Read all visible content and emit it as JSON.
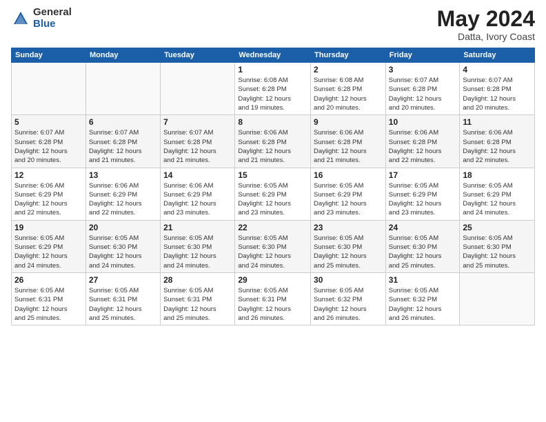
{
  "logo": {
    "general": "General",
    "blue": "Blue"
  },
  "title": {
    "month": "May 2024",
    "location": "Datta, Ivory Coast"
  },
  "weekdays": [
    "Sunday",
    "Monday",
    "Tuesday",
    "Wednesday",
    "Thursday",
    "Friday",
    "Saturday"
  ],
  "weeks": [
    [
      {
        "day": "",
        "info": ""
      },
      {
        "day": "",
        "info": ""
      },
      {
        "day": "",
        "info": ""
      },
      {
        "day": "1",
        "info": "Sunrise: 6:08 AM\nSunset: 6:28 PM\nDaylight: 12 hours\nand 19 minutes."
      },
      {
        "day": "2",
        "info": "Sunrise: 6:08 AM\nSunset: 6:28 PM\nDaylight: 12 hours\nand 20 minutes."
      },
      {
        "day": "3",
        "info": "Sunrise: 6:07 AM\nSunset: 6:28 PM\nDaylight: 12 hours\nand 20 minutes."
      },
      {
        "day": "4",
        "info": "Sunrise: 6:07 AM\nSunset: 6:28 PM\nDaylight: 12 hours\nand 20 minutes."
      }
    ],
    [
      {
        "day": "5",
        "info": "Sunrise: 6:07 AM\nSunset: 6:28 PM\nDaylight: 12 hours\nand 20 minutes."
      },
      {
        "day": "6",
        "info": "Sunrise: 6:07 AM\nSunset: 6:28 PM\nDaylight: 12 hours\nand 21 minutes."
      },
      {
        "day": "7",
        "info": "Sunrise: 6:07 AM\nSunset: 6:28 PM\nDaylight: 12 hours\nand 21 minutes."
      },
      {
        "day": "8",
        "info": "Sunrise: 6:06 AM\nSunset: 6:28 PM\nDaylight: 12 hours\nand 21 minutes."
      },
      {
        "day": "9",
        "info": "Sunrise: 6:06 AM\nSunset: 6:28 PM\nDaylight: 12 hours\nand 21 minutes."
      },
      {
        "day": "10",
        "info": "Sunrise: 6:06 AM\nSunset: 6:28 PM\nDaylight: 12 hours\nand 22 minutes."
      },
      {
        "day": "11",
        "info": "Sunrise: 6:06 AM\nSunset: 6:28 PM\nDaylight: 12 hours\nand 22 minutes."
      }
    ],
    [
      {
        "day": "12",
        "info": "Sunrise: 6:06 AM\nSunset: 6:29 PM\nDaylight: 12 hours\nand 22 minutes."
      },
      {
        "day": "13",
        "info": "Sunrise: 6:06 AM\nSunset: 6:29 PM\nDaylight: 12 hours\nand 22 minutes."
      },
      {
        "day": "14",
        "info": "Sunrise: 6:06 AM\nSunset: 6:29 PM\nDaylight: 12 hours\nand 23 minutes."
      },
      {
        "day": "15",
        "info": "Sunrise: 6:05 AM\nSunset: 6:29 PM\nDaylight: 12 hours\nand 23 minutes."
      },
      {
        "day": "16",
        "info": "Sunrise: 6:05 AM\nSunset: 6:29 PM\nDaylight: 12 hours\nand 23 minutes."
      },
      {
        "day": "17",
        "info": "Sunrise: 6:05 AM\nSunset: 6:29 PM\nDaylight: 12 hours\nand 23 minutes."
      },
      {
        "day": "18",
        "info": "Sunrise: 6:05 AM\nSunset: 6:29 PM\nDaylight: 12 hours\nand 24 minutes."
      }
    ],
    [
      {
        "day": "19",
        "info": "Sunrise: 6:05 AM\nSunset: 6:29 PM\nDaylight: 12 hours\nand 24 minutes."
      },
      {
        "day": "20",
        "info": "Sunrise: 6:05 AM\nSunset: 6:30 PM\nDaylight: 12 hours\nand 24 minutes."
      },
      {
        "day": "21",
        "info": "Sunrise: 6:05 AM\nSunset: 6:30 PM\nDaylight: 12 hours\nand 24 minutes."
      },
      {
        "day": "22",
        "info": "Sunrise: 6:05 AM\nSunset: 6:30 PM\nDaylight: 12 hours\nand 24 minutes."
      },
      {
        "day": "23",
        "info": "Sunrise: 6:05 AM\nSunset: 6:30 PM\nDaylight: 12 hours\nand 25 minutes."
      },
      {
        "day": "24",
        "info": "Sunrise: 6:05 AM\nSunset: 6:30 PM\nDaylight: 12 hours\nand 25 minutes."
      },
      {
        "day": "25",
        "info": "Sunrise: 6:05 AM\nSunset: 6:30 PM\nDaylight: 12 hours\nand 25 minutes."
      }
    ],
    [
      {
        "day": "26",
        "info": "Sunrise: 6:05 AM\nSunset: 6:31 PM\nDaylight: 12 hours\nand 25 minutes."
      },
      {
        "day": "27",
        "info": "Sunrise: 6:05 AM\nSunset: 6:31 PM\nDaylight: 12 hours\nand 25 minutes."
      },
      {
        "day": "28",
        "info": "Sunrise: 6:05 AM\nSunset: 6:31 PM\nDaylight: 12 hours\nand 25 minutes."
      },
      {
        "day": "29",
        "info": "Sunrise: 6:05 AM\nSunset: 6:31 PM\nDaylight: 12 hours\nand 26 minutes."
      },
      {
        "day": "30",
        "info": "Sunrise: 6:05 AM\nSunset: 6:32 PM\nDaylight: 12 hours\nand 26 minutes."
      },
      {
        "day": "31",
        "info": "Sunrise: 6:05 AM\nSunset: 6:32 PM\nDaylight: 12 hours\nand 26 minutes."
      },
      {
        "day": "",
        "info": ""
      }
    ]
  ]
}
